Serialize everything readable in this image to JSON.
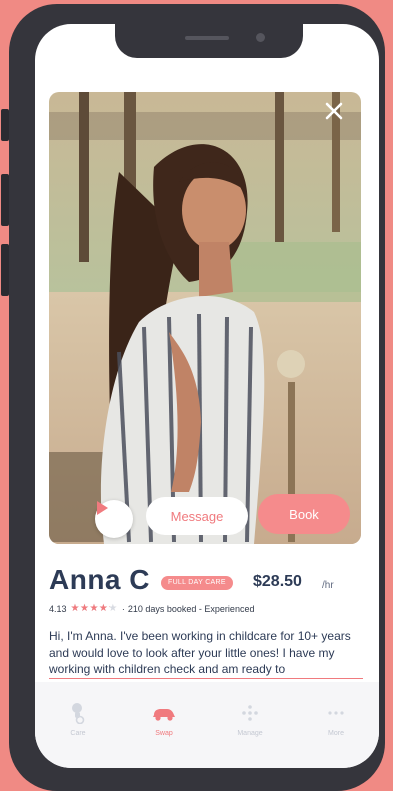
{
  "profile": {
    "name": "Anna C",
    "badge": "FULL DAY CARE",
    "price": "$28.50",
    "price_unit": "/hr",
    "rating_value": "4.13",
    "rating_out_of_5": 4.13,
    "days_booked": "210 days booked",
    "experience": "Experienced",
    "bio": "Hi, I'm Anna. I've been working in childcare for 10+ years and would love to look after your little ones! I have my working with children check and am ready to"
  },
  "photo_actions": {
    "message_label": "Message",
    "book_label": "Book"
  },
  "tabs": [
    {
      "label": "Care",
      "icon": "care-icon",
      "active": false
    },
    {
      "label": "Swap",
      "icon": "swap-icon",
      "active": true
    },
    {
      "label": "Manage",
      "icon": "manage-icon",
      "active": false
    },
    {
      "label": "More",
      "icon": "more-icon",
      "active": false
    }
  ],
  "colors": {
    "accent": "#f07a7e",
    "book_button": "#f58b8c",
    "text_dark": "#2d3b56",
    "background": "#f08a84",
    "phone_frame": "#35353c"
  }
}
